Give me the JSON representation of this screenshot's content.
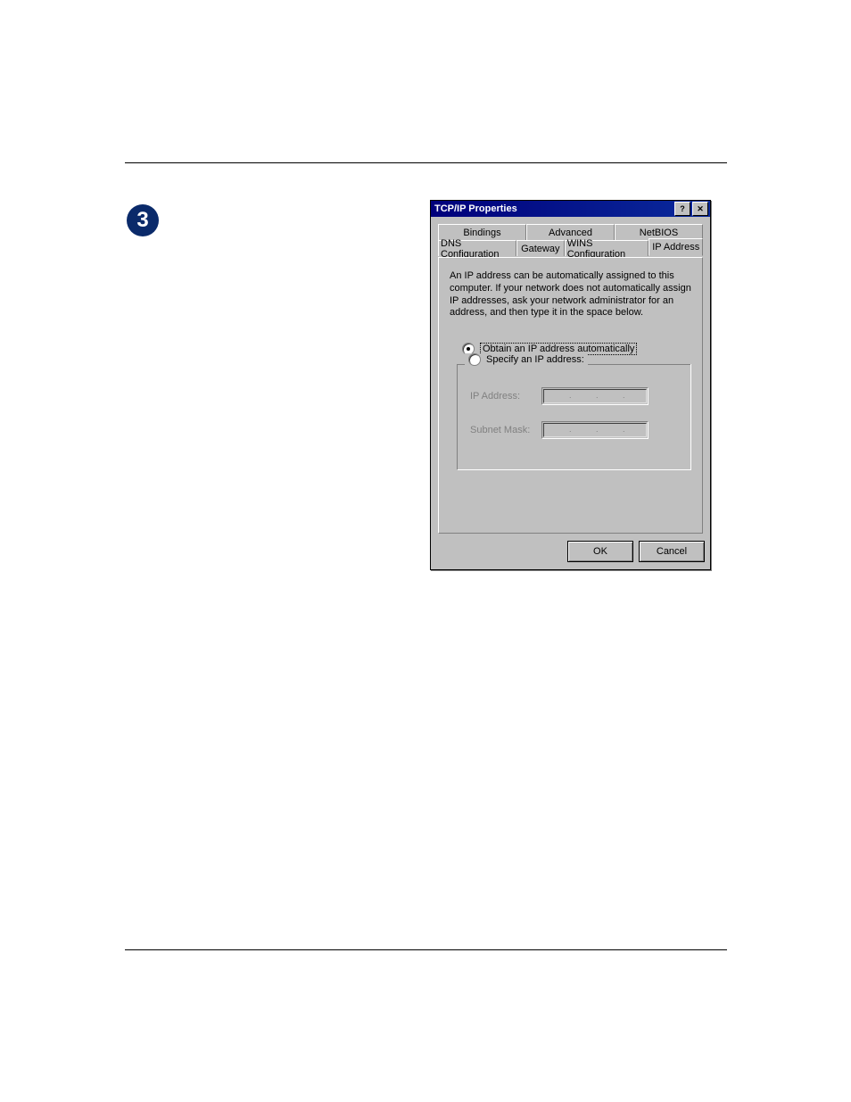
{
  "step_number": "3",
  "dialog": {
    "title": "TCP/IP Properties",
    "tabs": {
      "bindings": "Bindings",
      "advanced": "Advanced",
      "netbios": "NetBIOS",
      "dns": "DNS Configuration",
      "gateway": "Gateway",
      "wins": "WINS Configuration",
      "ip_address": "IP Address"
    },
    "info_text": "An IP address can be automatically assigned to this computer. If your network does not automatically assign IP addresses, ask your network administrator for an address, and then type it in the space below.",
    "radios": {
      "obtain": "Obtain an IP address automatically",
      "specify": "Specify an IP address:"
    },
    "fields": {
      "ip_label": "IP Address:",
      "mask_label": "Subnet Mask:"
    },
    "buttons": {
      "ok": "OK",
      "cancel": "Cancel"
    }
  }
}
